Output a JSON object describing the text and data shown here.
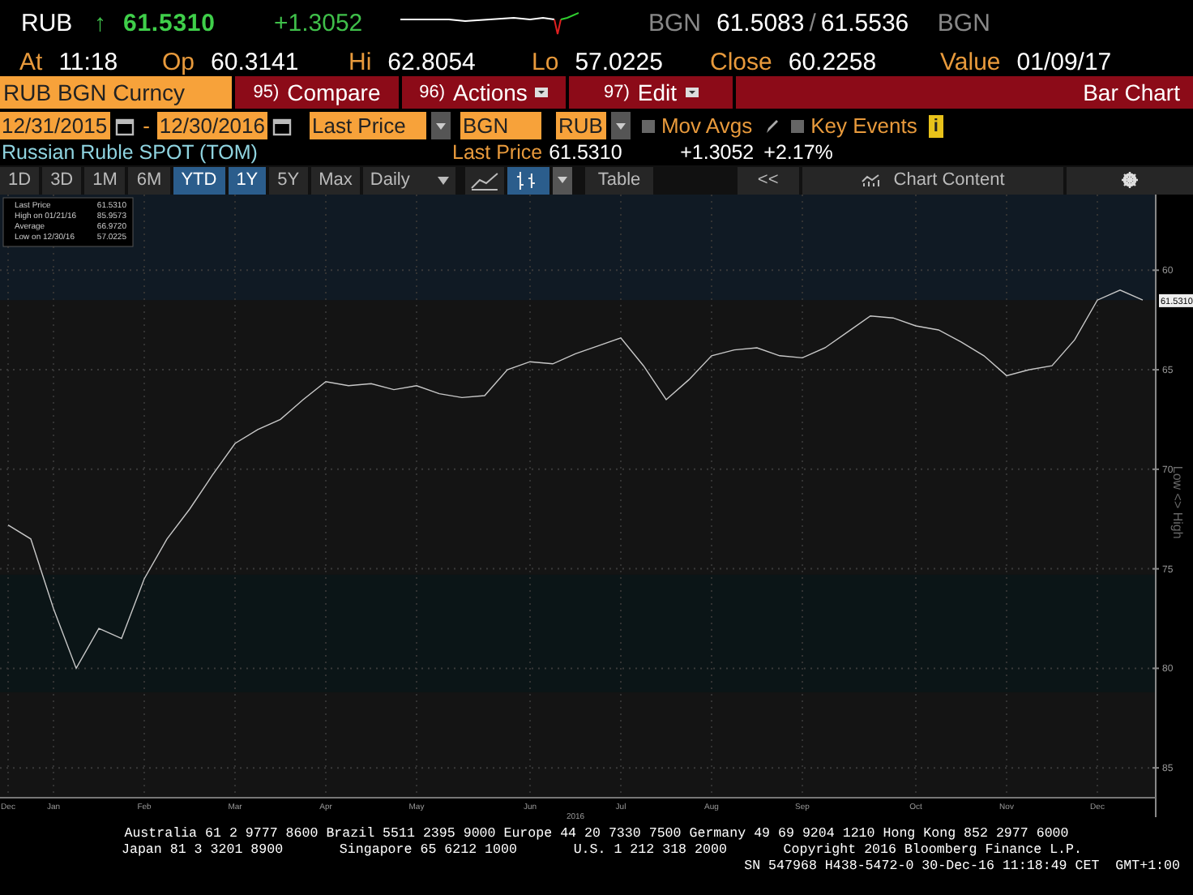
{
  "header": {
    "symbol": "RUB",
    "arrow": "↑",
    "price": "61.5310",
    "change": "+1.3052",
    "bid_source": "BGN",
    "bid": "61.5083",
    "separator": "/",
    "ask": "61.5536",
    "ask_source": "BGN"
  },
  "stats": [
    {
      "label": "At",
      "value": "11:18"
    },
    {
      "label": "Op",
      "value": "60.3141"
    },
    {
      "label": "Hi",
      "value": "62.8054"
    },
    {
      "label": "Lo",
      "value": "57.0225"
    },
    {
      "label": "Close",
      "value": "60.2258"
    },
    {
      "label": "Value",
      "value": "01/09/17"
    }
  ],
  "command_bar": {
    "security": "RUB BGN Curncy",
    "menus": [
      {
        "number": "95)",
        "label": "Compare",
        "has_menu": false
      },
      {
        "number": "96)",
        "label": "Actions",
        "has_menu": true
      },
      {
        "number": "97)",
        "label": "Edit",
        "has_menu": true
      }
    ],
    "title": "Bar Chart"
  },
  "controls": {
    "start_date": "12/31/2015",
    "dash": "-",
    "end_date": "12/30/2016",
    "field": "Last Price",
    "source": "BGN",
    "currency": "RUB",
    "options": [
      {
        "label": "Mov Avgs",
        "checked": false
      },
      {
        "label": "Key Events",
        "checked": false
      }
    ],
    "info": "i"
  },
  "subtitle": {
    "name": "Russian Ruble SPOT (TOM)",
    "last_label": "Last Price",
    "last_value": "61.5310",
    "change": "+1.3052",
    "percent": "+2.17%"
  },
  "toolbar": {
    "periods": [
      {
        "label": "1D",
        "selected": false
      },
      {
        "label": "3D",
        "selected": false
      },
      {
        "label": "1M",
        "selected": false
      },
      {
        "label": "6M",
        "selected": false
      },
      {
        "label": "YTD",
        "selected": true
      },
      {
        "label": "1Y",
        "selected": true
      },
      {
        "label": "5Y",
        "selected": false
      },
      {
        "label": "Max",
        "selected": false
      }
    ],
    "frequency": "Daily",
    "table": "Table",
    "back": "<<",
    "chart_content": "Chart Content"
  },
  "legend": [
    {
      "value": "61.5310"
    },
    {
      "label": "High on 01/21/16",
      "value": "85.9573"
    },
    {
      "label": "Average",
      "value": "66.9720"
    },
    {
      "label": "Low on 12/30/16",
      "value": "57.0225"
    }
  ],
  "price_tag": "61.5310",
  "chart_year": "2016",
  "chart_data": {
    "type": "line",
    "ylabel": "Low <> High",
    "grid": true,
    "bands": [
      {
        "axis": "y",
        "from": 56.2,
        "to": 61.5,
        "color": "#101a24"
      },
      {
        "axis": "y",
        "from": 75.3,
        "to": 81.2,
        "color": "#0b1517"
      }
    ],
    "ylim": [
      86.5,
      56.2
    ],
    "categories": [
      "Dec",
      null,
      "Jan",
      null,
      null,
      null,
      "Feb",
      null,
      null,
      null,
      "Mar",
      null,
      null,
      null,
      "Apr",
      null,
      null,
      null,
      "May",
      null,
      null,
      null,
      null,
      "Jun",
      null,
      null,
      null,
      "Jul",
      null,
      null,
      null,
      "Aug",
      null,
      null,
      null,
      "Sep",
      null,
      null,
      null,
      null,
      "Oct",
      null,
      null,
      null,
      "Nov",
      null,
      null,
      null,
      "Dec",
      null,
      null
    ],
    "yticks": [
      60,
      65,
      70,
      75,
      80,
      85
    ],
    "series": [
      {
        "name": "Last Price",
        "color": "#c8c8c8",
        "values": [
          72.8,
          73.5,
          77,
          80,
          78,
          78.5,
          75.5,
          73.5,
          72,
          70.3,
          68.7,
          68,
          67.5,
          66.5,
          65.6,
          65.8,
          65.7,
          66,
          65.8,
          66.2,
          66.4,
          66.3,
          65,
          64.6,
          64.7,
          64.2,
          63.8,
          63.4,
          64.8,
          66.5,
          65.5,
          64.3,
          64,
          63.9,
          64.3,
          64.4,
          63.9,
          63.1,
          62.3,
          62.4,
          62.8,
          63,
          63.6,
          64.3,
          65.3,
          65,
          64.8,
          63.5,
          61.5,
          61,
          61.5
        ]
      }
    ]
  },
  "footer": [
    "Australia 61 2 9777 8600 Brazil 5511 2395 9000 Europe 44 20 7330 7500 Germany 49 69 9204 1210 Hong Kong 852 2977 6000",
    "Japan 81 3 3201 8900       Singapore 65 6212 1000       U.S. 1 212 318 2000       Copyright 2016 Bloomberg Finance L.P.",
    "SN 547968 H438-5472-0 30-Dec-16 11:18:49 CET  GMT+1:00"
  ]
}
